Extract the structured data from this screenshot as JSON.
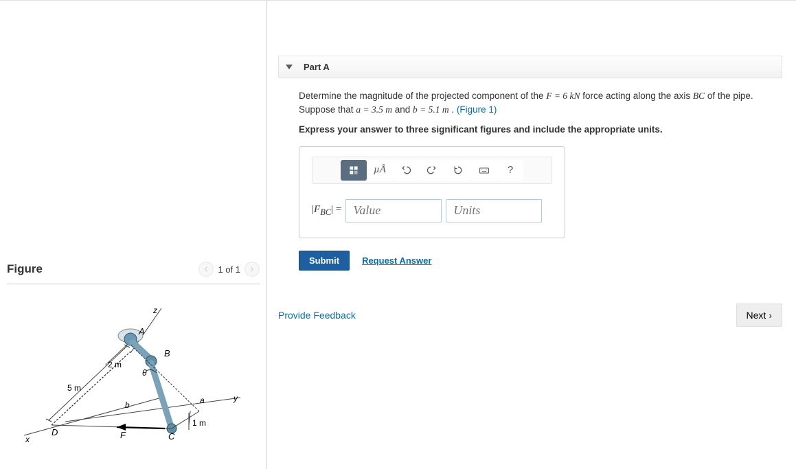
{
  "figure": {
    "title": "Figure",
    "page_label": "1 of 1",
    "labels": {
      "z": "z",
      "y": "y",
      "x": "x",
      "A": "A",
      "B": "B",
      "C": "C",
      "D": "D",
      "F": "F",
      "theta": "θ",
      "a": "a",
      "b": "b"
    },
    "dims": {
      "five_m": "5 m",
      "two_m": "2 m",
      "one_m": "1 m"
    }
  },
  "part": {
    "letter": "Part A",
    "prompt_1a": "Determine the magnitude of the projected component of the ",
    "F_eq": "F = 6  kN",
    "prompt_1b": " force acting along the axis ",
    "BC": "BC",
    "prompt_1c": " of the pipe. Suppose that ",
    "a_eq": "a = 3.5  m",
    "and": " and ",
    "b_eq": "b = 5.1  m",
    "period": " . ",
    "fig_link": "(Figure 1)",
    "instruction": "Express your answer to three significant figures and include the appropriate units."
  },
  "toolbar": {
    "units_symbol": "µÅ",
    "help": "?"
  },
  "answer": {
    "lhs_open": "|",
    "lhs_var": "F",
    "lhs_sub": "BC",
    "lhs_close": "| =",
    "value_placeholder": "Value",
    "units_placeholder": "Units"
  },
  "buttons": {
    "submit": "Submit",
    "request": "Request Answer",
    "feedback": "Provide Feedback",
    "next": "Next"
  }
}
